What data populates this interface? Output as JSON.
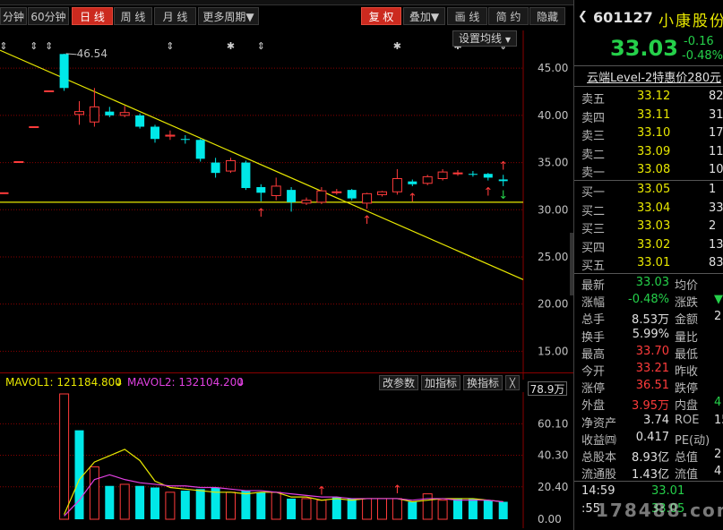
{
  "toolbar": {
    "buttons": [
      "分钟",
      "60分钟",
      "日 线",
      "周 线",
      "月 线",
      "更多周期▼"
    ],
    "right_buttons": [
      "复 权",
      "叠加▼",
      "画 线",
      "简 约",
      "隐藏"
    ]
  },
  "main_chart": {
    "setting_label": "设置均线",
    "y_ticks": [
      "45.00",
      "40.00",
      "35.00",
      "30.00",
      "25.00",
      "20.00",
      "15.00"
    ],
    "max_label": "46.54"
  },
  "volume": {
    "mavol1_label": "MAVOL1: 121184.800",
    "mavol2_label": "MAVOL2: 132104.200",
    "buttons": [
      "改参数",
      "加指标",
      "换指标"
    ],
    "close_label": "╳",
    "unit_label": "78.9万",
    "y_ticks": [
      "60.10",
      "40.30",
      "20.40",
      "0.00"
    ]
  },
  "chart_data": {
    "type": "candlestick",
    "ylim": [
      12,
      49
    ],
    "candles": [
      {
        "o": 31.8,
        "c": 31.8,
        "h": 31.8,
        "l": 31.8
      },
      {
        "o": 35.1,
        "c": 35.1,
        "h": 35.1,
        "l": 35.1
      },
      {
        "o": 38.8,
        "c": 38.8,
        "h": 38.8,
        "l": 38.8
      },
      {
        "o": 42.6,
        "c": 42.6,
        "h": 42.6,
        "l": 42.6
      },
      {
        "o": 46.5,
        "c": 42.9,
        "h": 46.54,
        "l": 42.6
      },
      {
        "o": 40.1,
        "c": 40.4,
        "h": 41.5,
        "l": 39.0
      },
      {
        "o": 39.3,
        "c": 40.9,
        "h": 42.9,
        "l": 38.8
      },
      {
        "o": 40.4,
        "c": 40.0,
        "h": 40.9,
        "l": 39.8
      },
      {
        "o": 40.0,
        "c": 40.3,
        "h": 41.0,
        "l": 39.8
      },
      {
        "o": 40.0,
        "c": 38.8,
        "h": 40.2,
        "l": 38.6
      },
      {
        "o": 38.8,
        "c": 37.5,
        "h": 39.0,
        "l": 37.1
      },
      {
        "o": 37.8,
        "c": 37.9,
        "h": 38.4,
        "l": 37.4
      },
      {
        "o": 37.5,
        "c": 37.4,
        "h": 37.9,
        "l": 37.0
      },
      {
        "o": 37.4,
        "c": 35.4,
        "h": 37.5,
        "l": 35.1
      },
      {
        "o": 35.0,
        "c": 33.9,
        "h": 35.5,
        "l": 33.4
      },
      {
        "o": 34.1,
        "c": 35.2,
        "h": 35.5,
        "l": 33.9
      },
      {
        "o": 35.0,
        "c": 32.3,
        "h": 35.2,
        "l": 32.1
      },
      {
        "o": 32.4,
        "c": 31.8,
        "h": 32.7,
        "l": 30.9
      },
      {
        "o": 31.5,
        "c": 32.5,
        "h": 33.4,
        "l": 31.0
      },
      {
        "o": 32.1,
        "c": 30.8,
        "h": 32.4,
        "l": 29.8
      },
      {
        "o": 30.7,
        "c": 31.0,
        "h": 31.3,
        "l": 30.5
      },
      {
        "o": 30.8,
        "c": 32.0,
        "h": 32.4,
        "l": 30.6
      },
      {
        "o": 31.9,
        "c": 31.9,
        "h": 32.2,
        "l": 31.6
      },
      {
        "o": 32.1,
        "c": 31.2,
        "h": 32.2,
        "l": 31.0
      },
      {
        "o": 30.7,
        "c": 31.7,
        "h": 31.8,
        "l": 30.1
      },
      {
        "o": 31.6,
        "c": 31.9,
        "h": 32.0,
        "l": 31.4
      },
      {
        "o": 31.9,
        "c": 33.3,
        "h": 34.3,
        "l": 31.6
      },
      {
        "o": 33.0,
        "c": 32.7,
        "h": 33.2,
        "l": 32.5
      },
      {
        "o": 32.8,
        "c": 33.5,
        "h": 33.7,
        "l": 32.6
      },
      {
        "o": 33.3,
        "c": 34.0,
        "h": 34.3,
        "l": 33.1
      },
      {
        "o": 33.9,
        "c": 33.9,
        "h": 34.2,
        "l": 33.6
      },
      {
        "o": 33.8,
        "c": 33.7,
        "h": 34.1,
        "l": 33.5
      },
      {
        "o": 33.8,
        "c": 33.4,
        "h": 33.9,
        "l": 33.1
      },
      {
        "o": 33.21,
        "c": 33.03,
        "h": 33.7,
        "l": 32.5
      }
    ],
    "horizontal_line": 30.8,
    "trend_line": {
      "start_y": 46.9,
      "end_y": 22.6
    },
    "volume_ylim": [
      0,
      78.9
    ],
    "volume": [
      0,
      0,
      0,
      0,
      78.9,
      56,
      33,
      21,
      22,
      21,
      20,
      17,
      18,
      19,
      20,
      17,
      18,
      17,
      17,
      13,
      13,
      12,
      14,
      13,
      13,
      13,
      13,
      11,
      16,
      12,
      13,
      13,
      12,
      11
    ],
    "volume_up": [
      false,
      false,
      false,
      false,
      true,
      false,
      true,
      false,
      true,
      false,
      false,
      true,
      false,
      false,
      false,
      true,
      false,
      false,
      true,
      false,
      true,
      true,
      false,
      false,
      true,
      true,
      true,
      false,
      true,
      true,
      false,
      false,
      false,
      false
    ],
    "mavol_line": [
      0,
      0,
      0,
      0,
      3,
      25,
      36,
      40,
      44,
      37,
      24,
      20,
      19,
      18,
      17,
      17,
      16,
      17,
      17,
      14,
      14,
      12,
      13,
      12,
      13,
      13,
      13,
      11,
      12,
      13,
      13,
      13,
      12,
      11
    ],
    "mavol2_line": [
      0,
      0,
      0,
      0,
      2,
      12,
      25,
      28,
      25,
      23,
      22,
      21,
      21,
      20,
      20,
      19,
      18,
      18,
      17,
      16,
      15,
      14,
      14,
      13,
      13,
      13,
      13,
      12,
      13,
      13,
      12,
      12,
      12,
      11
    ],
    "up_arrows": [
      17,
      24,
      27,
      32
    ],
    "top_markers": [
      "arrow",
      "none",
      "arrow",
      "arrow",
      "none",
      "none",
      "none",
      "none",
      "none",
      "none",
      "none",
      "arrow",
      "none",
      "none",
      "none",
      "star",
      "none",
      "arrow",
      "none",
      "none",
      "none",
      "none",
      "none",
      "none",
      "none",
      "none",
      "star",
      "none",
      "none",
      "none",
      "star",
      "none",
      "none",
      "arrow"
    ]
  },
  "panel": {
    "code": "601127",
    "name": "小康股份",
    "price": "33.03",
    "change": "-0.16",
    "change_pct": "-0.48%",
    "promo": "云端Level-2特惠价280元",
    "asks": [
      {
        "label": "卖五",
        "price": "33.12",
        "vol": "82"
      },
      {
        "label": "卖四",
        "price": "33.11",
        "vol": "31"
      },
      {
        "label": "卖三",
        "price": "33.10",
        "vol": "179"
      },
      {
        "label": "卖二",
        "price": "33.09",
        "vol": "116"
      },
      {
        "label": "卖一",
        "price": "33.08",
        "vol": "10"
      }
    ],
    "bids": [
      {
        "label": "买一",
        "price": "33.05",
        "vol": "1"
      },
      {
        "label": "买二",
        "price": "33.04",
        "vol": "33"
      },
      {
        "label": "买三",
        "price": "33.03",
        "vol": "2"
      },
      {
        "label": "买四",
        "price": "33.02",
        "vol": "13"
      },
      {
        "label": "买五",
        "price": "33.01",
        "vol": "83"
      }
    ],
    "stats": [
      {
        "l1": "最新",
        "v1": "33.03",
        "c1": "green",
        "l2": "均价",
        "v2": "",
        "c2": "white"
      },
      {
        "l1": "涨幅",
        "v1": "-0.48%",
        "c1": "green",
        "l2": "涨跌",
        "v2": "▼",
        "c2": "green"
      },
      {
        "l1": "总手",
        "v1": "8.53万",
        "c1": "white",
        "l2": "金额",
        "v2": "2",
        "c2": "white"
      },
      {
        "l1": "换手",
        "v1": "5.99%",
        "c1": "white",
        "l2": "量比",
        "v2": "",
        "c2": "white"
      },
      {
        "l1": "最高",
        "v1": "33.70",
        "c1": "red",
        "l2": "最低",
        "v2": "",
        "c2": "white"
      },
      {
        "l1": "今开",
        "v1": "33.21",
        "c1": "red",
        "l2": "昨收",
        "v2": "",
        "c2": "white"
      },
      {
        "l1": "涨停",
        "v1": "36.51",
        "c1": "red",
        "l2": "跌停",
        "v2": "",
        "c2": "white"
      },
      {
        "l1": "外盘",
        "v1": "3.95万",
        "c1": "red",
        "l2": "内盘",
        "v2": "4",
        "c2": "green"
      },
      {
        "l1": "净资产",
        "v1": "3.74",
        "c1": "white",
        "l2": "ROE",
        "v2": "15",
        "c2": "white"
      },
      {
        "l1": "收益㈣",
        "v1": "0.417",
        "c1": "white",
        "l2": "PE(动)",
        "v2": "",
        "c2": "white"
      },
      {
        "l1": "总股本",
        "v1": "8.93亿",
        "c1": "white",
        "l2": "总值",
        "v2": "2",
        "c2": "white"
      },
      {
        "l1": "流通股",
        "v1": "1.43亿",
        "c1": "white",
        "l2": "流值",
        "v2": "4",
        "c2": "white"
      }
    ],
    "ticks": [
      {
        "time": "14:59",
        "price": "33.01"
      },
      {
        "time": ":55",
        "price": "33.05"
      }
    ],
    "watermark": "178488.com"
  },
  "colors": {
    "up": "#ff3b3b",
    "down": "#00e8e8",
    "trend": "#e8e800",
    "mavol2": "#e040e0"
  }
}
